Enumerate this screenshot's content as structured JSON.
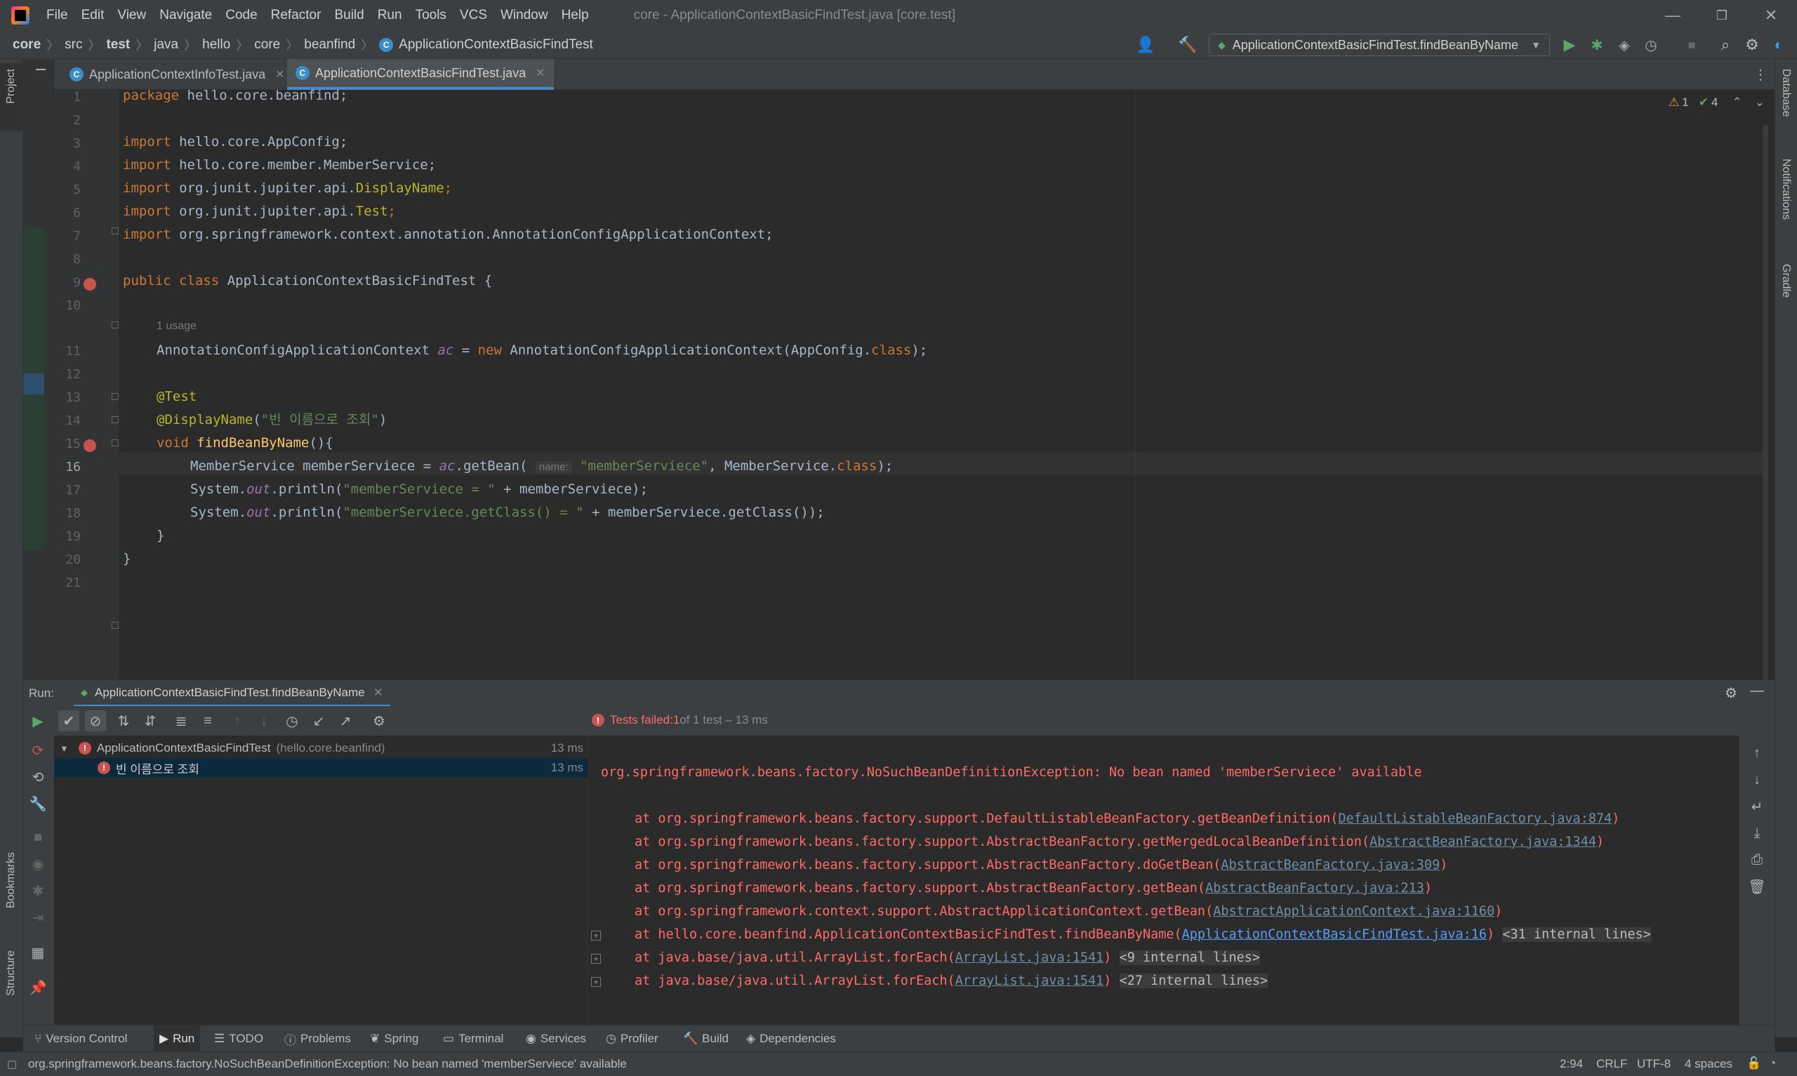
{
  "menu": [
    "File",
    "Edit",
    "View",
    "Navigate",
    "Code",
    "Refactor",
    "Build",
    "Run",
    "Tools",
    "VCS",
    "Window",
    "Help"
  ],
  "window_title": "core - ApplicationContextBasicFindTest.java [core.test]",
  "breadcrumbs": [
    "core",
    "src",
    "test",
    "java",
    "hello",
    "core",
    "beanfind",
    "ApplicationContextBasicFindTest"
  ],
  "run_config": "ApplicationContextBasicFindTest.findBeanByName",
  "tabs": [
    {
      "label": "ApplicationContextInfoTest.java",
      "active": false
    },
    {
      "label": "ApplicationContextBasicFindTest.java",
      "active": true
    }
  ],
  "inspections": {
    "warnings": "1",
    "ok": "4"
  },
  "editor": {
    "usage_hint": "1 usage",
    "param_hint": "name:",
    "line_numbers": [
      "1",
      "2",
      "3",
      "4",
      "5",
      "6",
      "7",
      "8",
      "9",
      "10",
      "11",
      "12",
      "13",
      "14",
      "15",
      "16",
      "17",
      "18",
      "19",
      "20",
      "21"
    ],
    "current_line": "16",
    "lines": {
      "l1_kw": "package",
      "l1_rest": " hello.core.beanfind;",
      "l3": "hello.core.AppConfig;",
      "l4": "hello.core.member.MemberService;",
      "l5_a": "org.junit.jupiter.api.",
      "l5_b": "DisplayName",
      "l6_a": "org.junit.jupiter.api.",
      "l6_b": "Test",
      "l7": "org.springframework.context.annotation.AnnotationConfigApplicationContext;",
      "import_kw": "import",
      "l9_kw": "public class",
      "l9_rest": " ApplicationContextBasicFindTest {",
      "l11_a": "AnnotationConfigApplicationContext ",
      "l11_b": "ac",
      "l11_c": " = ",
      "l11_new": "new",
      "l11_d": " AnnotationConfigApplicationContext(AppConfig.",
      "l11_cls": "class",
      "l11_e": ");",
      "l13": "@Test",
      "l14_a": "@DisplayName",
      "l14_b": "(",
      "l14_str": "\"빈 이름으로 조회\"",
      "l14_c": ")",
      "l15_kw": "void",
      "l15_fn": "findBeanByName",
      "l15_rest": "(){",
      "l16_a": "MemberService memberServiece = ",
      "l16_ac": "ac",
      "l16_b": ".getBean(",
      "l16_str": "\"memberServiece\"",
      "l16_c": ", MemberService.",
      "l16_cls": "class",
      "l16_d": ");",
      "l17_a": "System.",
      "l17_out": "out",
      "l17_b": ".println(",
      "l17_str": "\"memberServiece = \"",
      "l17_c": " + memberServiece);",
      "l18_a": "System.",
      "l18_out": "out",
      "l18_b": ".println(",
      "l18_str": "\"memberServiece.getClass() = \"",
      "l18_c": " + memberServiece.getClass());",
      "l19": "}",
      "l20": "}",
      "semi": ";"
    }
  },
  "run_panel": {
    "label": "Run:",
    "tab": "ApplicationContextBasicFindTest.findBeanByName",
    "status_prefix": "Tests failed: ",
    "status_failed": "1",
    "status_suffix": " of 1 test – 13 ms",
    "tree": [
      {
        "name": "ApplicationContextBasicFindTest",
        "pkg": "(hello.core.beanfind)",
        "time": "13 ms"
      },
      {
        "name": "빈 이름으로 조회",
        "time": "13 ms"
      }
    ],
    "console": {
      "exception": "org.springframework.beans.factory.NoSuchBeanDefinitionException: No bean named 'memberServiece' available",
      "frames": [
        {
          "text": "at org.springframework.beans.factory.support.DefaultListableBeanFactory.getBeanDefinition(",
          "link": "DefaultListableBeanFactory.java:874",
          "end": ")",
          "fold": ""
        },
        {
          "text": "at org.springframework.beans.factory.support.AbstractBeanFactory.getMergedLocalBeanDefinition(",
          "link": "AbstractBeanFactory.java:1344",
          "end": ")",
          "fold": ""
        },
        {
          "text": "at org.springframework.beans.factory.support.AbstractBeanFactory.doGetBean(",
          "link": "AbstractBeanFactory.java:309",
          "end": ")",
          "fold": ""
        },
        {
          "text": "at org.springframework.beans.factory.support.AbstractBeanFactory.getBean(",
          "link": "AbstractBeanFactory.java:213",
          "end": ")",
          "fold": ""
        },
        {
          "text": "at org.springframework.context.support.AbstractApplicationContext.getBean(",
          "link": "AbstractApplicationContext.java:1160",
          "end": ")",
          "fold": ""
        },
        {
          "text": "at hello.core.beanfind.ApplicationContextBasicFindTest.findBeanByName(",
          "link": "ApplicationContextBasicFindTest.java:16",
          "end": ")",
          "fold": "<31 internal lines>"
        },
        {
          "text": "at java.base/java.util.ArrayList.forEach(",
          "link": "ArrayList.java:1541",
          "end": ")",
          "fold": "<9 internal lines>"
        },
        {
          "text": "at java.base/java.util.ArrayList.forEach(",
          "link": "ArrayList.java:1541",
          "end": ")",
          "fold": "<27 internal lines>"
        }
      ]
    }
  },
  "tool_windows": [
    "Version Control",
    "Run",
    "TODO",
    "Problems",
    "Spring",
    "Terminal",
    "Services",
    "Profiler",
    "Build",
    "Dependencies"
  ],
  "side_labels": {
    "project": "Project",
    "bookmarks": "Bookmarks",
    "structure": "Structure",
    "database": "Database",
    "notifications": "Notifications",
    "gradle": "Gradle"
  },
  "status_bar": {
    "message": "org.springframework.beans.factory.NoSuchBeanDefinitionException: No bean named 'memberServiece' available",
    "position": "2:94",
    "line_sep": "CRLF",
    "encoding": "UTF-8",
    "indent": "4 spaces"
  },
  "colors": {
    "error": "#ff6b68",
    "keyword": "#cc7832",
    "string": "#6a8759",
    "annotation": "#bbb529",
    "accent": "#4a88c7"
  }
}
